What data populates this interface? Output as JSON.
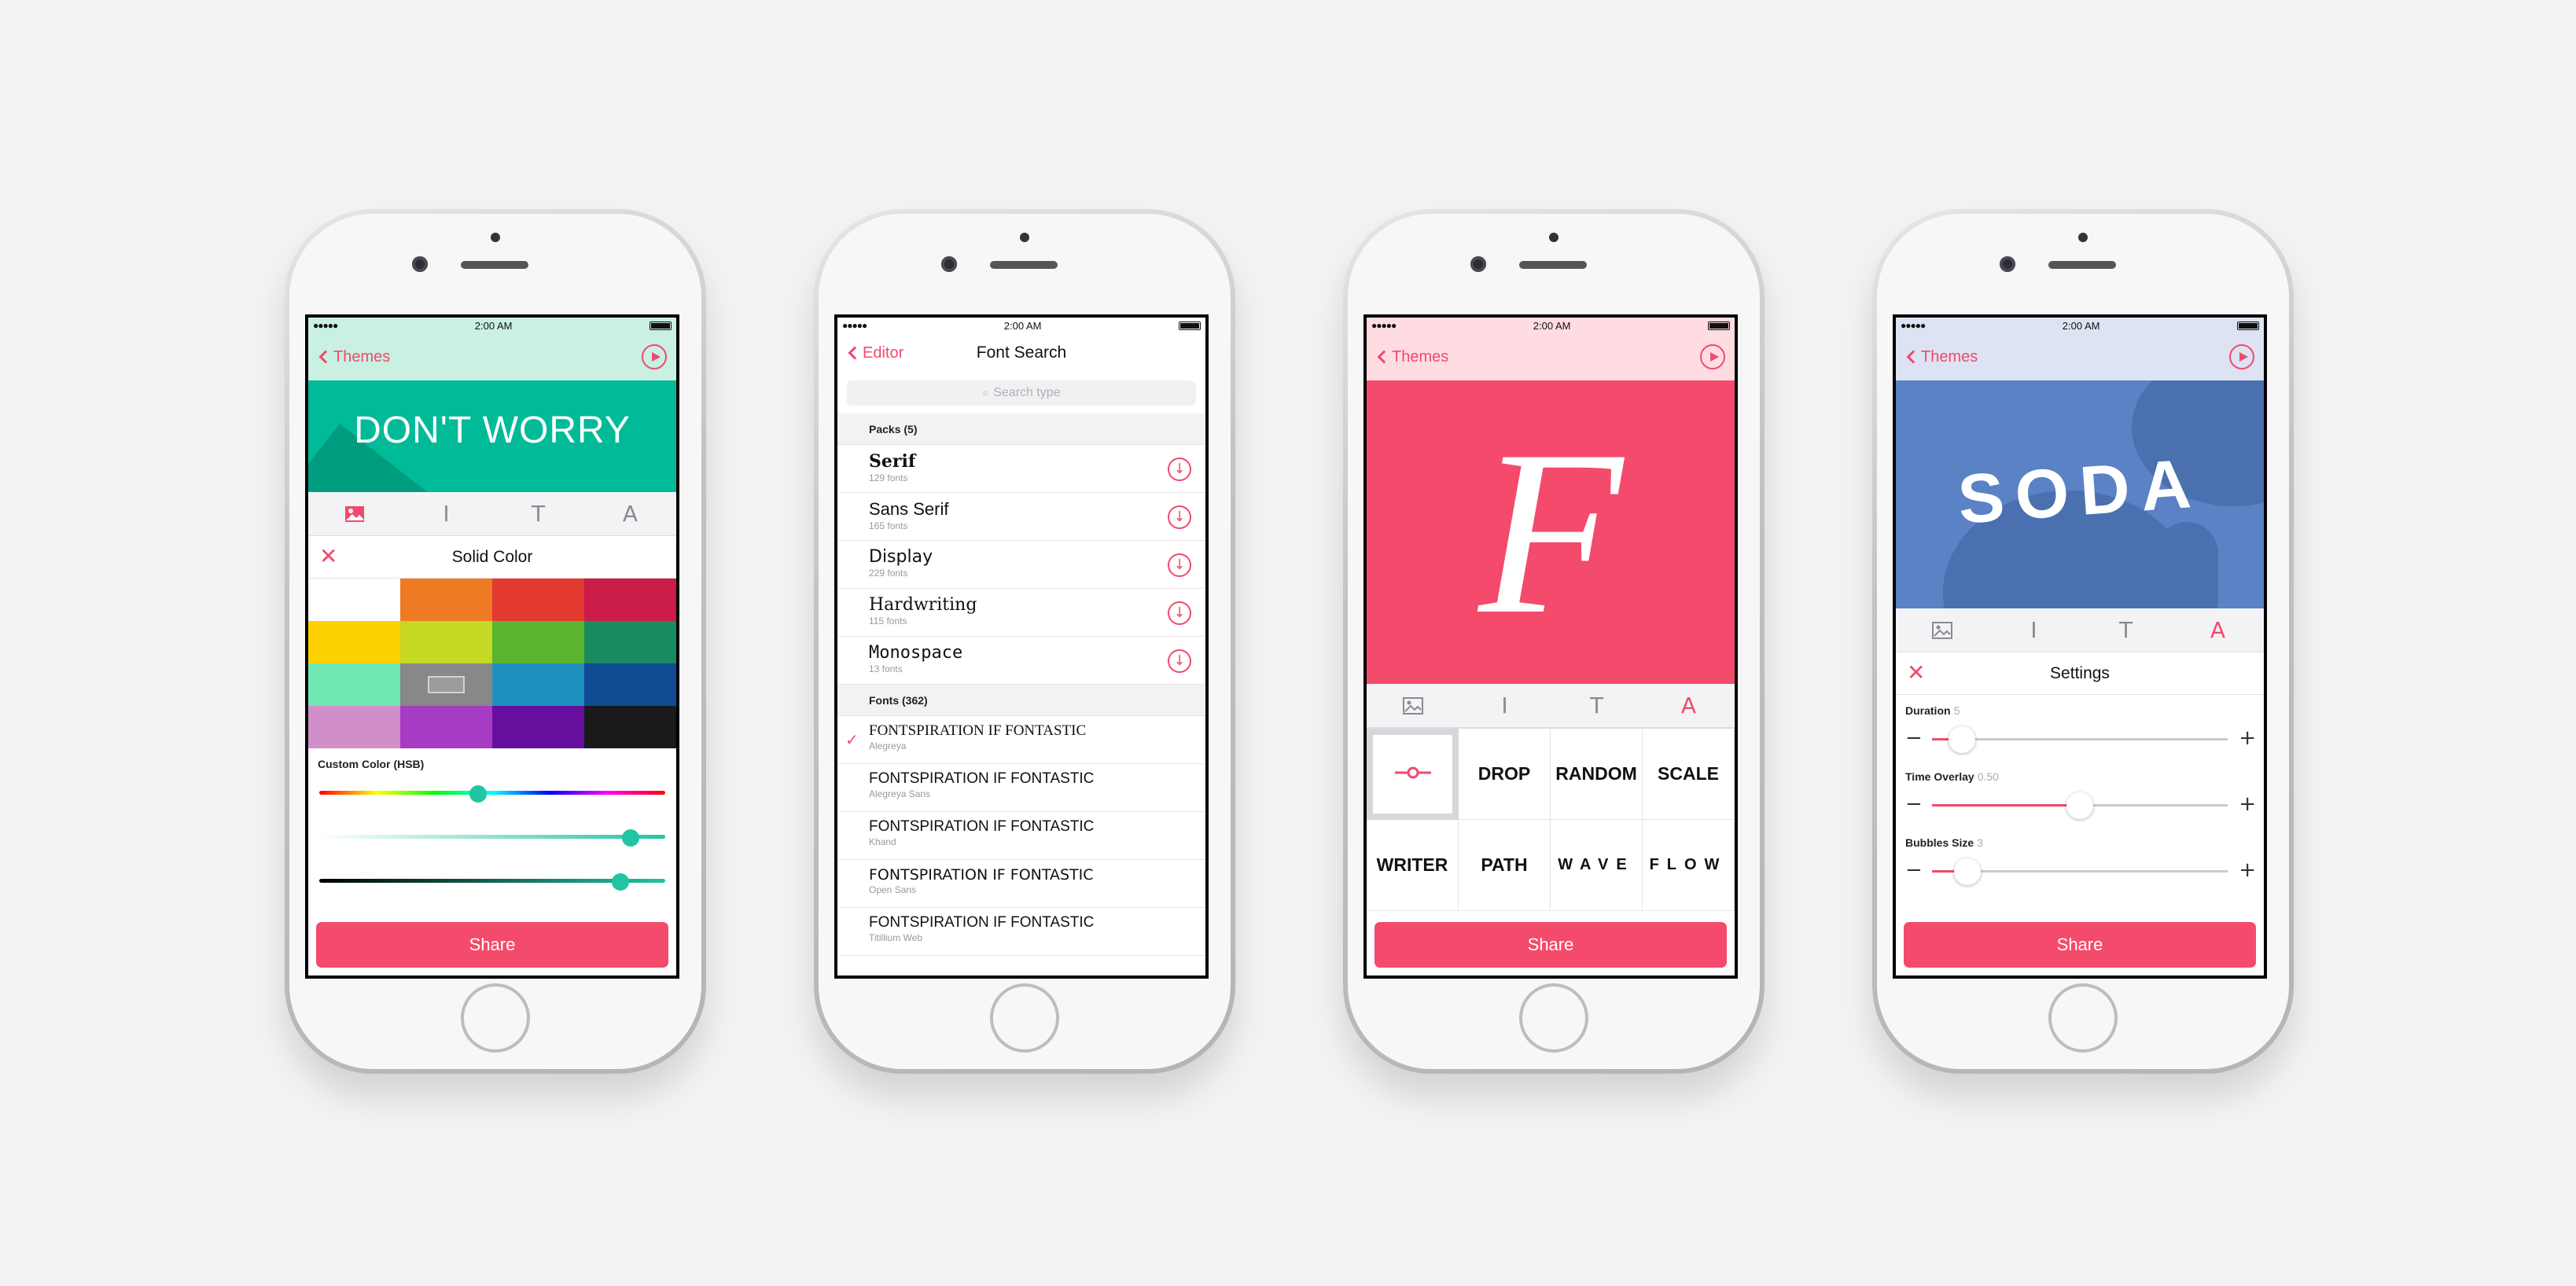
{
  "accent": "#f04a6c",
  "status": {
    "time": "2:00 AM",
    "signal": "●●●●●"
  },
  "phone1": {
    "back_label": "Themes",
    "preview_text": "DON'T WORRY",
    "toolbar_icons": [
      "image-icon",
      "text-cursor-icon",
      "text-style-icon",
      "animation-icon"
    ],
    "panel_title": "Solid Color",
    "swatches": [
      "#ffffff",
      "#ee7a24",
      "#e23a2f",
      "#cc1c4a",
      "#fed200",
      "#c5d824",
      "#5ab42e",
      "#1a8b5f",
      "#6fe8b1",
      "#888888",
      "#1e90c0",
      "#104b93",
      "#d18ec9",
      "#a63cc4",
      "#650f9f",
      "#1a1a1a"
    ],
    "selected_swatch": 9,
    "custom_color_label": "Custom Color (HSB)",
    "hue": 0.46,
    "saturation": 0.9,
    "brightness": 0.87,
    "share_label": "Share"
  },
  "phone2": {
    "back_label": "Editor",
    "title": "Font Search",
    "search_placeholder": "Search type",
    "packs_header": "Packs (5)",
    "packs": [
      {
        "name": "Serif",
        "count": "129 fonts"
      },
      {
        "name": "Sans Serif",
        "count": "165 fonts"
      },
      {
        "name": "Display",
        "count": "229 fonts"
      },
      {
        "name": "Hardwriting",
        "count": "115 fonts"
      },
      {
        "name": "Monospace",
        "count": "13 fonts"
      }
    ],
    "fonts_header": "Fonts (362)",
    "fonts": [
      {
        "sample": "FONTSPIRATION IF FONTASTIC",
        "name": "Alegreya"
      },
      {
        "sample": "FONTSPIRATION IF FONTASTIC",
        "name": "Alegreya Sans"
      },
      {
        "sample": "FONTSPIRATION IF FONTASTIC",
        "name": "Khand"
      },
      {
        "sample": "FONTSPIRATION IF FONTASTIC",
        "name": "Open Sans"
      },
      {
        "sample": "FONTSPIRATION IF FONTASTIC",
        "name": "Titillium Web"
      }
    ]
  },
  "phone3": {
    "back_label": "Themes",
    "preview_letter": "F",
    "effects": [
      "",
      "DROP",
      "RANDOM",
      "SCALE",
      "WRITER",
      "PATH",
      "WAVE",
      "FLOW"
    ],
    "share_label": "Share"
  },
  "phone4": {
    "back_label": "Themes",
    "preview_text": "SODA",
    "panel_title": "Settings",
    "settings": [
      {
        "label": "Duration",
        "value": "5",
        "level": 0.1
      },
      {
        "label": "Time Overlay",
        "value": "0.50",
        "level": 0.5
      },
      {
        "label": "Bubbles Size",
        "value": "3",
        "level": 0.12
      }
    ],
    "share_label": "Share"
  }
}
